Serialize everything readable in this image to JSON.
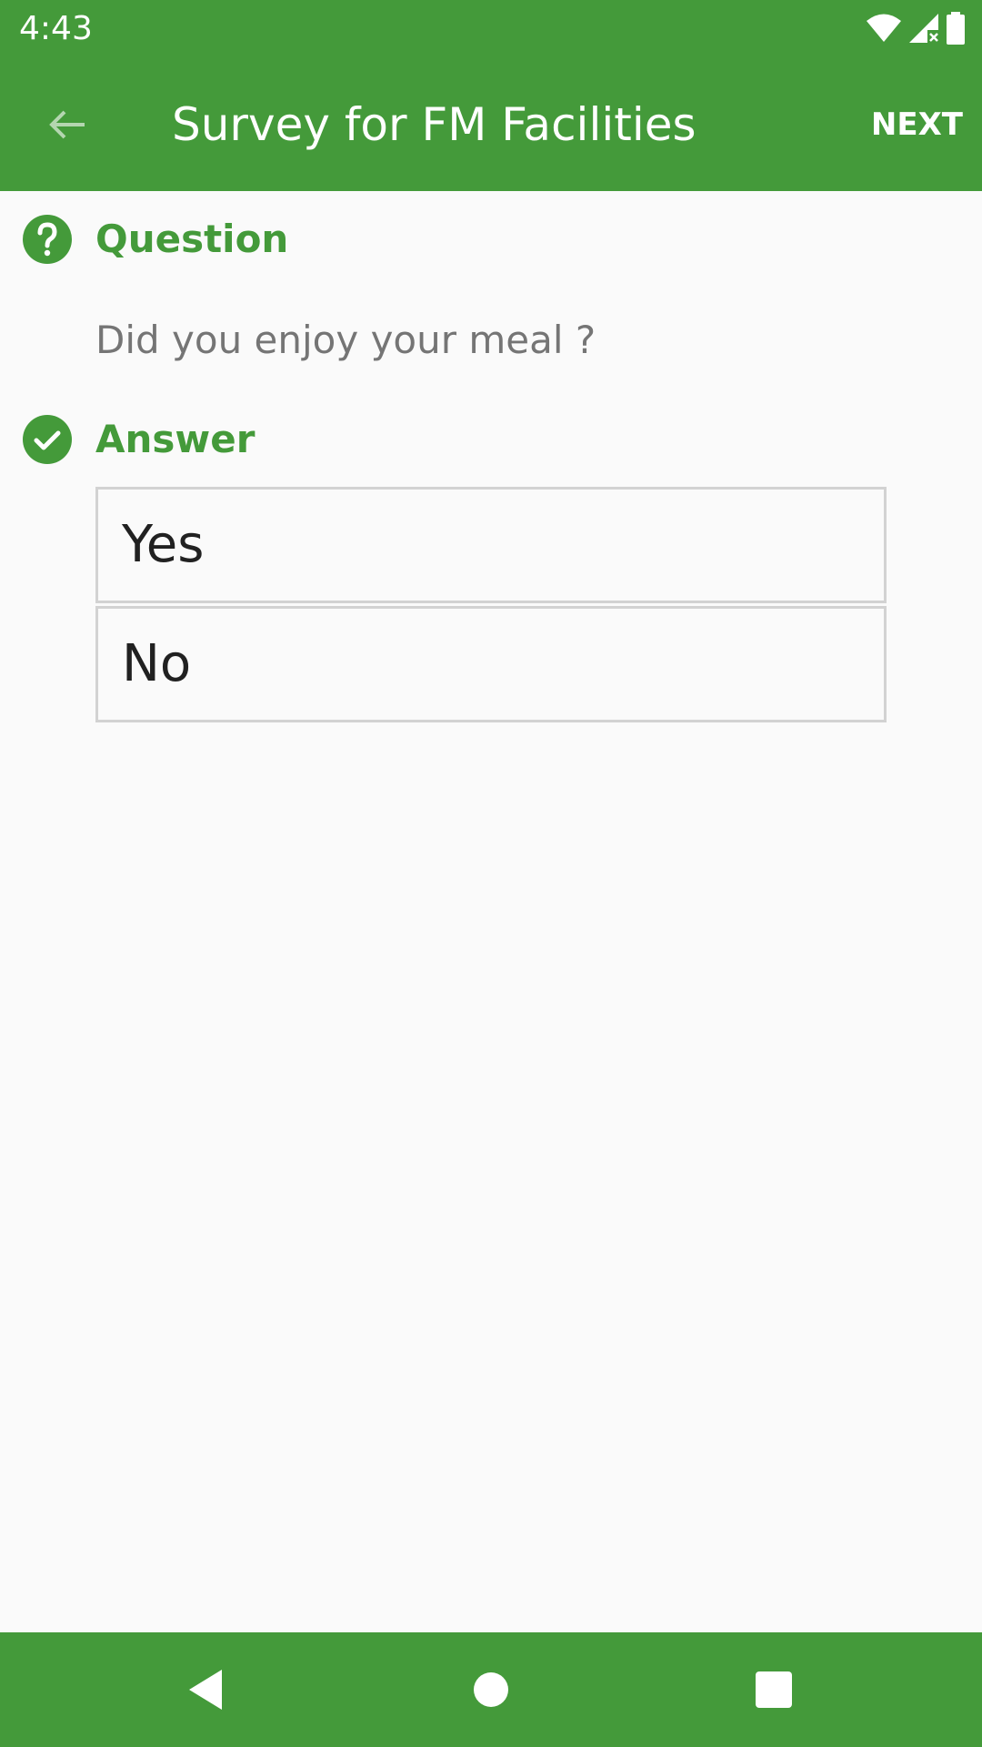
{
  "status_bar": {
    "time": "4:43",
    "icons": [
      "wifi-icon",
      "cellular-no-data-icon",
      "battery-icon"
    ]
  },
  "app_bar": {
    "back_icon": "arrow-back-icon",
    "title": "Survey for FM Facilities",
    "next_label": "NEXT"
  },
  "question": {
    "icon": "help-circle-icon",
    "heading": "Question",
    "text": "Did you enjoy your meal ?"
  },
  "answer": {
    "icon": "check-circle-icon",
    "heading": "Answer",
    "options": [
      "Yes",
      "No"
    ]
  },
  "nav_bar": {
    "icons": [
      "nav-back-icon",
      "nav-home-icon",
      "nav-recents-icon"
    ]
  },
  "colors": {
    "primary": "#449A3A",
    "background": "#FAFAFA",
    "question_text": "#757575",
    "option_text": "#212121",
    "option_border": "#D2D2D2"
  }
}
